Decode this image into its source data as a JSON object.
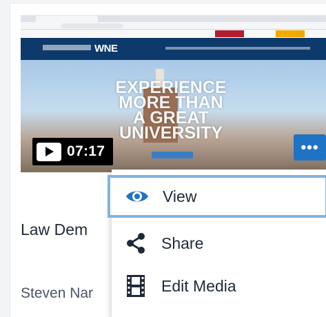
{
  "thumbnail": {
    "hero_lines": [
      "EXPERIENCE",
      "MORE THAN",
      "A GREAT",
      "UNIVERSITY"
    ],
    "logo": "WNE",
    "duration": "07:17"
  },
  "media": {
    "title": "Law Dem",
    "owner": "Steven Nar"
  },
  "menu": {
    "items": [
      {
        "label": "View",
        "icon": "eye-icon"
      },
      {
        "label": "Share",
        "icon": "share-icon"
      },
      {
        "label": "Edit Media",
        "icon": "film-icon"
      }
    ]
  },
  "more_button": {
    "label": "•••"
  },
  "colors": {
    "accent": "#1f73c4",
    "focus_ring": "#7fb4e2",
    "icon": "#1f2937"
  }
}
